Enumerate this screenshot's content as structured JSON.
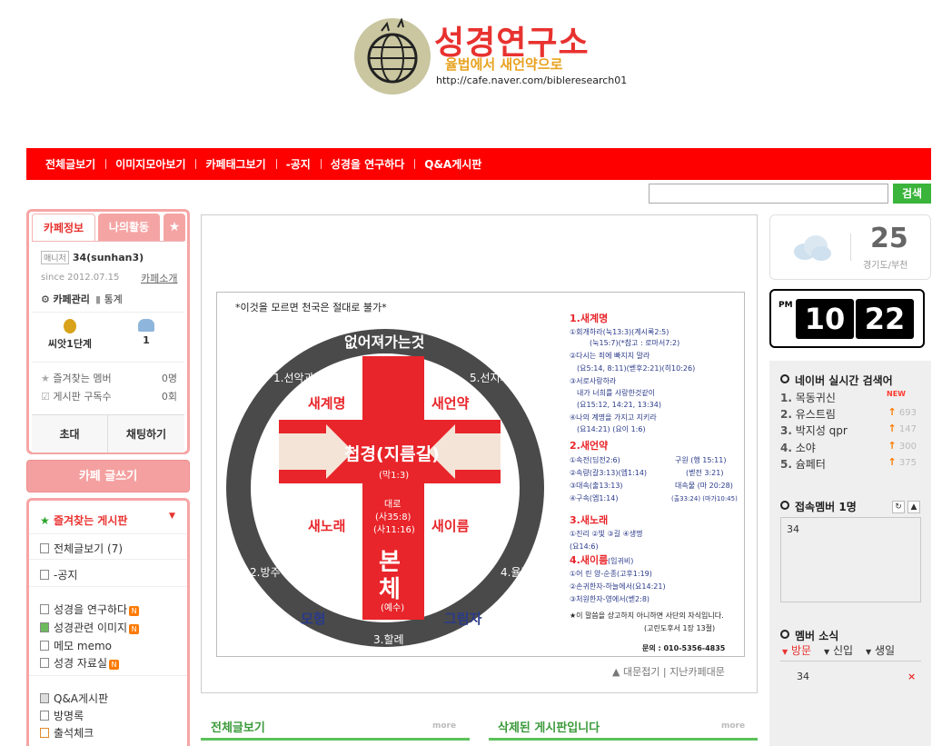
{
  "header": {
    "title": "성경연구소",
    "subtitle": "율법에서 새언약으로",
    "url": "http://cafe.naver.com/bibleresearch01"
  },
  "menu": [
    "전체글보기",
    "이미지모아보기",
    "카페태그보기",
    "-공지",
    "성경을 연구하다",
    "Q&A게시판"
  ],
  "search": {
    "button": "검색",
    "value": ""
  },
  "cafe_info": {
    "tabs": {
      "info": "카페정보",
      "activity": "나의활동",
      "star": "★"
    },
    "manager_badge": "매니저",
    "manager": "34(sunhan3)",
    "since": "since 2012.07.15",
    "intro_link": "카페소개",
    "manage": "카페관리",
    "stats": "통계",
    "level": "씨앗1단계",
    "members": "1",
    "fav_members_label": "즐겨찾는 멤버",
    "fav_members_value": "0명",
    "subscribers_label": "게시판 구독수",
    "subscribers_value": "0회",
    "invite": "초대",
    "chat": "채팅하기"
  },
  "write_button": "카페 글쓰기",
  "boards": {
    "fav_title": "즐겨찾는 게시판",
    "items": [
      {
        "label": "전체글보기",
        "count": "(7)"
      },
      {
        "label": "-공지"
      },
      {
        "label": "성경을 연구하다",
        "new": "N"
      },
      {
        "label": "성경관련 이미지",
        "new": "N"
      },
      {
        "label": "메모 memo"
      },
      {
        "label": "성경 자료실",
        "new": "N"
      },
      {
        "label": "Q&A게시판"
      },
      {
        "label": "방명록"
      },
      {
        "label": "출석체크"
      }
    ]
  },
  "diagram": {
    "heading": "*이것을 모르면 천국은 절대로 불가*",
    "ring_top": "없어져가는것",
    "ring_labels": [
      "1.선악과",
      "5.선지자",
      "2.방주",
      "4.율법",
      "3.할례"
    ],
    "quadrants": [
      "새계명",
      "새언약",
      "새노래",
      "새이름"
    ],
    "bottom_labels": [
      "모형",
      "그림자"
    ],
    "center": "첩경(지름길)",
    "center_ref": "(막1:3)",
    "vertical_small": "대로\n(사35:8)\n(사11:16)",
    "body": "본\n체",
    "body_sub": "(예수)",
    "side_notes": [
      {
        "title": "1.새계명",
        "lines": [
          "①회개하라(눅13:3)(계시록2:5)",
          "(눅15:7)(*참고 : 로마서7:2)",
          "②다시는 죄에 빠지지 말라",
          "(요5:14, 8:11)(벧후2:21)(히10:26)",
          "③서로사랑하라",
          "내가 너희를 사랑한것같이",
          "(요15:12, 14:21, 13:34)",
          "④나의 계명을 가지고 지키라",
          "(요14:21) (요이 1:6)"
        ]
      },
      {
        "title": "2.새언약",
        "lines": [
          "①속전(딤전2:6)",
          "②속량(갈3:13)(엡1:14)",
          "③대속(출13:13)",
          "④구속(엡1:14)",
          "구원 (행 15:11)",
          "(벧전 3:21)",
          "대속물 (마 20:28)",
          "(출33:24) (마가10:45)"
        ]
      },
      {
        "title": "3.새노래",
        "lines": [
          "①진리 ②빛 ③길 ④생명",
          "(요14:6)"
        ]
      },
      {
        "title": "4.새이름",
        "lines": [
          "(임귀비)",
          "①어 린 양-순종(고후1:19)",
          "②손귀한자-하늘에서(요14:21)",
          "③처원한자-영에서(벧2:8)"
        ]
      }
    ],
    "footer_note": "★이 말씀을 상고하지 아니하면 사단의 자식입니다.",
    "footer_ref": "(고린도후서 1장 13절)",
    "contact": "문의 : 010-5356-4835"
  },
  "main_footer": {
    "collapse": "▲ 대문접기",
    "past": "지난카페대문"
  },
  "sections": [
    {
      "title": "전체글보기",
      "more": "more"
    },
    {
      "title": "삭제된 게시판입니다",
      "more": "more"
    }
  ],
  "weather": {
    "temp": "25",
    "region": "경기도/부천"
  },
  "clock": {
    "ampm": "PM",
    "hour": "10",
    "minute": "22"
  },
  "realtime": {
    "title": "네이버 실시간 검색어",
    "items": [
      {
        "rank": "1.",
        "text": "목동귀신",
        "change": "NEW"
      },
      {
        "rank": "2.",
        "text": "유스트림",
        "change": "693"
      },
      {
        "rank": "3.",
        "text": "박지성 qpr",
        "change": "147"
      },
      {
        "rank": "4.",
        "text": "소야",
        "change": "300"
      },
      {
        "rank": "5.",
        "text": "슘페터",
        "change": "375"
      }
    ]
  },
  "online": {
    "title": "접속멤버 1명",
    "member": "34"
  },
  "news": {
    "title": "멤버 소식",
    "tabs": [
      "방문",
      "신입",
      "생일"
    ],
    "item": "34"
  },
  "colors": {
    "brand": "#ff0000",
    "accent_green": "#3ab43a",
    "pink": "#f6a5a5"
  }
}
